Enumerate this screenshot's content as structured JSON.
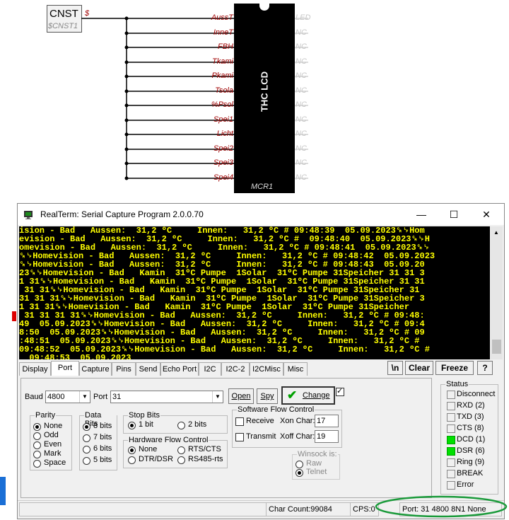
{
  "schematic": {
    "cnst_title": "CNST",
    "cnst_sub": "$CNST1",
    "dollar": "$",
    "input_pins": [
      "AussT",
      "InneT",
      "FBH",
      "Tkami",
      "Pkami",
      "Tsola",
      "%Psol",
      "Spei1",
      "Licht",
      "Spei2",
      "Spei3",
      "Spei4"
    ],
    "output_pins": [
      "LED",
      "NC",
      "NC",
      "NC",
      "NC",
      "NC",
      "NC",
      "NC",
      "NC",
      "NC",
      "NC",
      "NC"
    ],
    "ic_label": "THC LCD",
    "ic_name": "MCR1"
  },
  "window": {
    "title": "RealTerm: Serial Capture Program 2.0.0.70",
    "min": "—",
    "max": "☐",
    "close": "✕"
  },
  "terminal": {
    "lines": [
      "ision - Bad   Aussen:  31,2 ºC     Innen:   31,2 ºC # 09:48:39  05.09.2023␍␊Hom",
      "evision - Bad   Aussen:  31,2 ºC     Innen:   31,2 ºC #  09:48:40  05.09.2023␍␊H",
      "omevision - Bad   Aussen:  31,2 ºC     Innen:   31,2 ºC # 09:48:41  05.09.2023␍␊",
      "␍␊Homevision - Bad   Aussen:  31,2 ºC     Innen:   31,2 ºC # 09:48:42  05.09.2023",
      "␍␊Homevision - Bad   Aussen:  31,2 ºC     Innen:   31,2 ºC # 09:48:43  05.09.20",
      "23␍␊Homevision - Bad   Kamin  31ºC Pumpe  1Solar  31ºC Pumpe 31Speicher 31 31 3",
      "1 31␍␊Homevision - Bad   Kamin  31ºC Pumpe  1Solar  31ºC Pumpe 31Speicher 31 31",
      " 31 31␍␊Homevision - Bad   Kamin  31ºC Pumpe  1Solar  31ºC Pumpe 31Speicher 31",
      "31 31 31␍␊Homevision - Bad   Kamin  31ºC Pumpe  1Solar  31ºC Pumpe 31Speicher 3",
      "1 31 31␍␊Homevision - Bad   Kamin  31ºC Pumpe  1Solar  31ºC Pumpe 31Speicher",
      " 31 31 31 31␍␊Homevision - Bad   Aussen:  31,2 ºC     Innen:   31,2 ºC # 09:48:",
      "49  05.09.2023␍␊Homevision - Bad   Aussen:  31,2 ºC     Innen:   31,2 ºC # 09:4",
      "8:50  05.09.2023␍␊Homevision - Bad   Aussen:  31,2 ºC     Innen:   31,2 ºC # 09",
      ":48:51  05.09.2023␍␊Homevision - Bad   Aussen:  31,2 ºC     Innen:   31,2 ºC #",
      "09:48:52  05.09.2023␍␊Homevision - Bad   Aussen:  31,2 ºC     Innen:   31,2 ºC #",
      "  09:48:53  05.09.2023"
    ]
  },
  "tabs": [
    "Display",
    "Port",
    "Capture",
    "Pins",
    "Send",
    "Echo Port",
    "I2C",
    "I2C-2",
    "I2CMisc",
    "Misc"
  ],
  "active_tab": "Port",
  "tab_buttons": {
    "newline": "\\n",
    "clear": "Clear",
    "freeze": "Freeze",
    "help": "?"
  },
  "port": {
    "baud_label": "Baud",
    "baud_value": "4800",
    "port_label": "Port",
    "port_value": "31",
    "open_label": "Open",
    "spy_label": "Spy",
    "change_label": "Change"
  },
  "parity": {
    "title": "Parity",
    "options": [
      "None",
      "Odd",
      "Even",
      "Mark",
      "Space"
    ],
    "selected": 0
  },
  "data_bits": {
    "title": "Data Bits",
    "options": [
      "8 bits",
      "7 bits",
      "6 bits",
      "5 bits"
    ],
    "selected": 0
  },
  "stop_bits": {
    "title": "Stop Bits",
    "options": [
      "1 bit",
      "2 bits"
    ],
    "selected": 0
  },
  "hw_flow": {
    "title": "Hardware Flow Control",
    "options": [
      "None",
      "RTS/CTS",
      "DTR/DSR",
      "RS485-rts"
    ],
    "selected": 0
  },
  "sw_flow": {
    "title": "Software Flow Control",
    "receive_label": "Receive",
    "transmit_label": "Transmit",
    "xon_label": "Xon Char:",
    "xon_value": "17",
    "xoff_label": "Xoff Char:",
    "xoff_value": "19"
  },
  "winsock": {
    "title": "Winsock is:",
    "options": [
      "Raw",
      "Telnet"
    ],
    "selected": 1
  },
  "status": {
    "title": "Status",
    "items": [
      {
        "label": "Disconnect",
        "on": false
      },
      {
        "label": "RXD (2)",
        "on": false
      },
      {
        "label": "TXD (3)",
        "on": false
      },
      {
        "label": "CTS (8)",
        "on": false
      },
      {
        "label": "DCD (1)",
        "on": true
      },
      {
        "label": "DSR (6)",
        "on": true
      },
      {
        "label": "Ring (9)",
        "on": false
      },
      {
        "label": "BREAK",
        "on": false
      },
      {
        "label": "Error",
        "on": false
      }
    ],
    "on_color": "#00e000"
  },
  "statusbar": {
    "char_count": "Char Count:99084",
    "cps": "CPS:0",
    "port": "Port: 31 4800 8N1 None"
  }
}
